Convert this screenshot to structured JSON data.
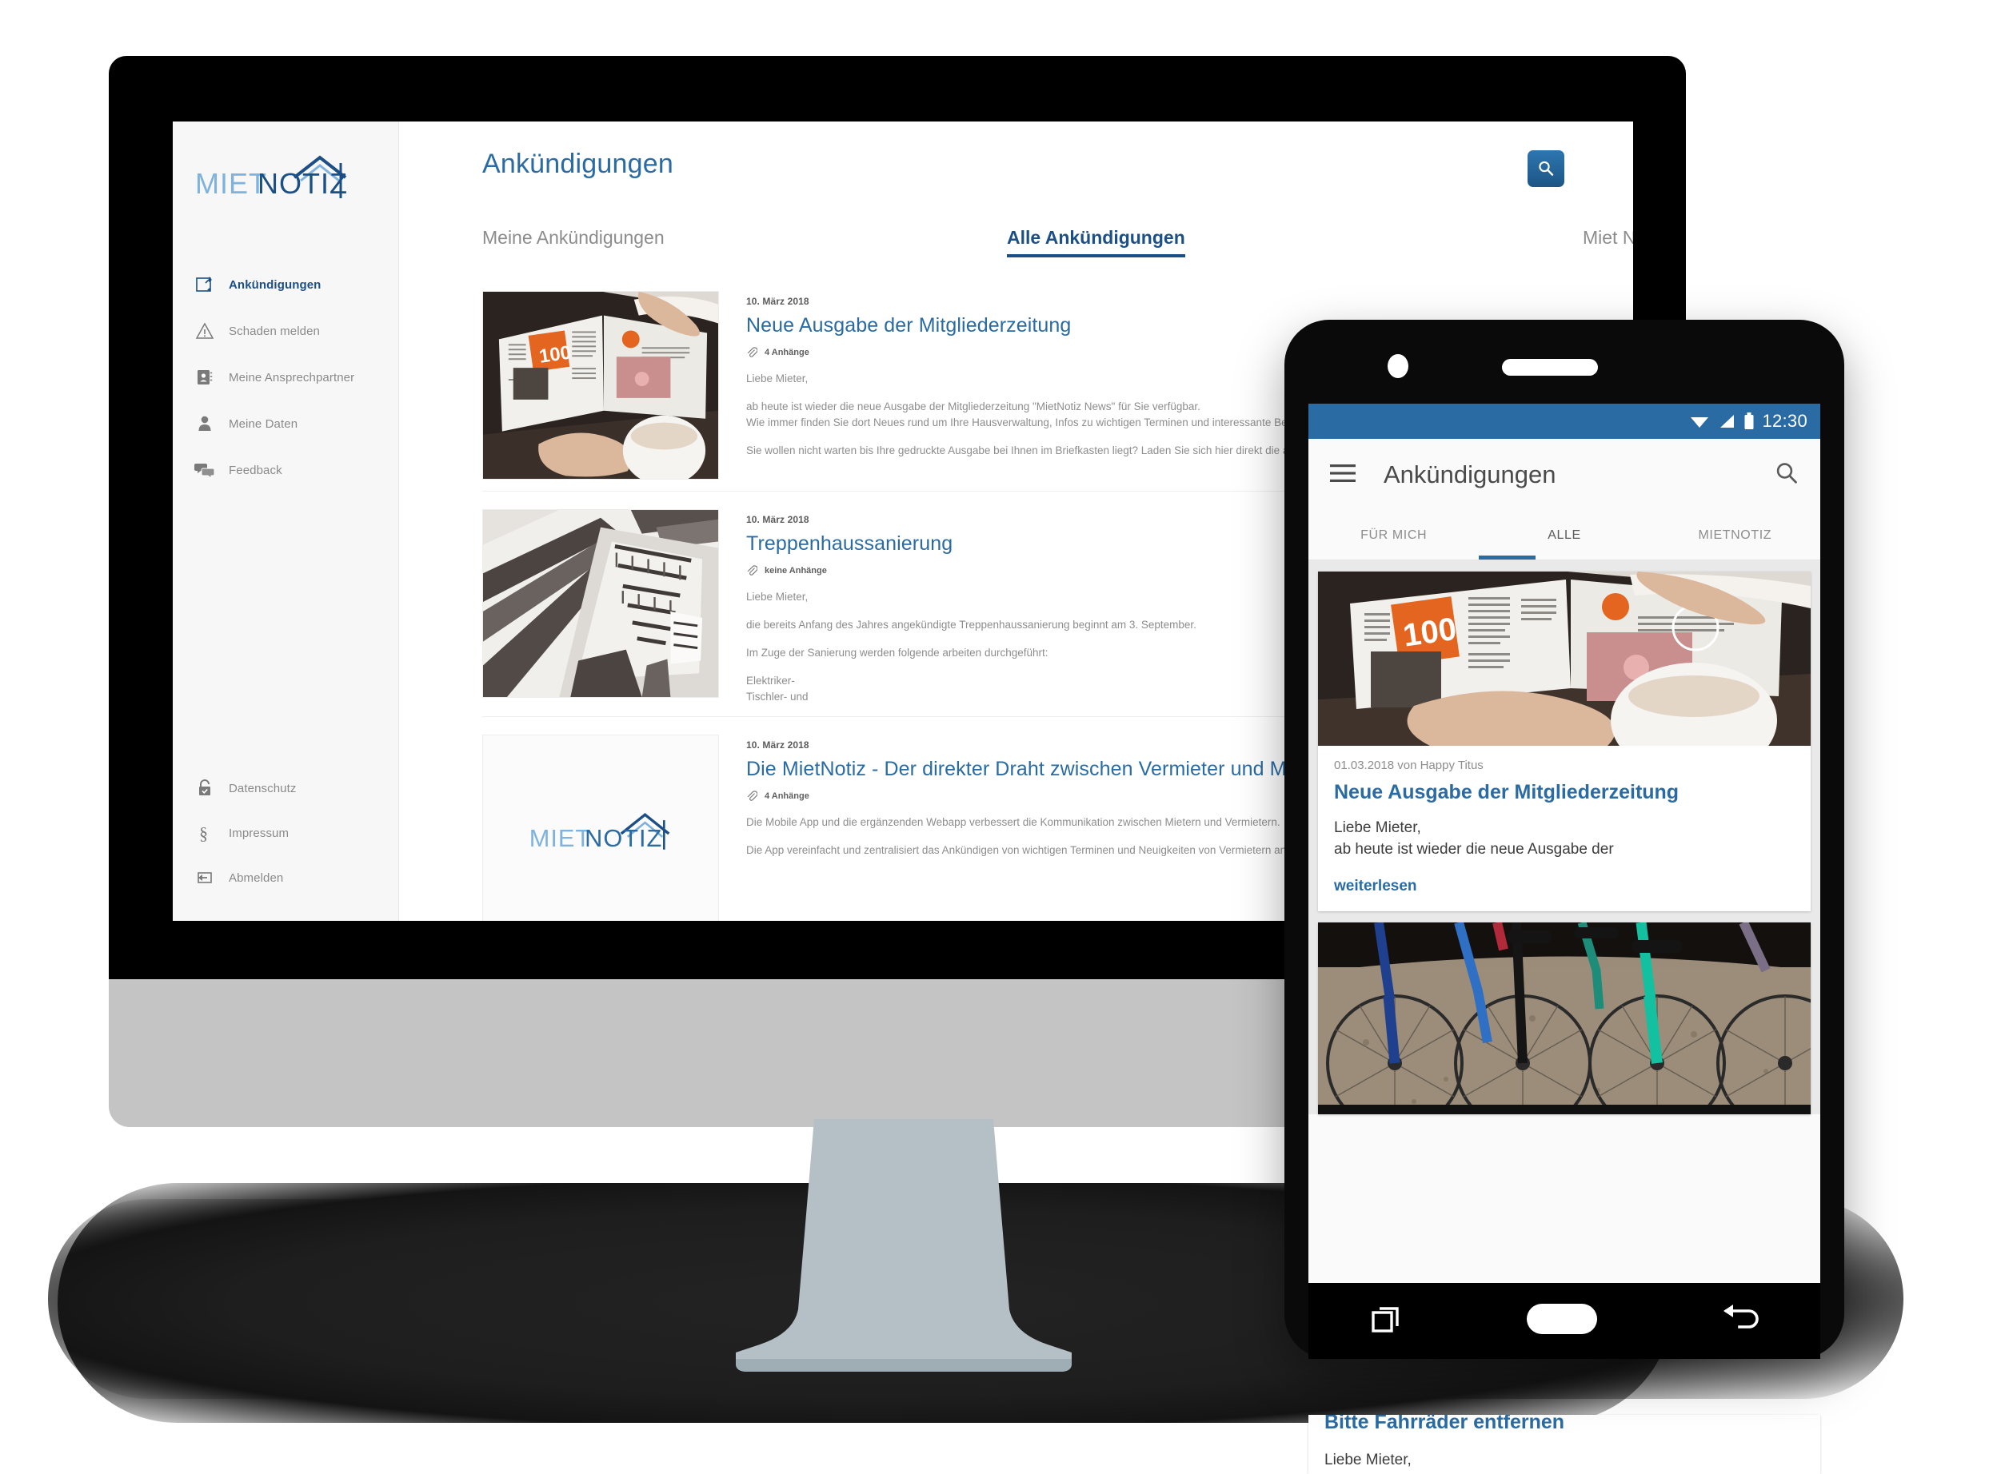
{
  "brand": {
    "logo_first": "MIET",
    "logo_second": "NOTIZ",
    "accent_blue": "#2a6ba3",
    "dark_blue": "#1b4f86",
    "light_blue": "#7fb3dd"
  },
  "desktop": {
    "page_title": "Ankündigungen",
    "search_icon": "search-icon",
    "sidebar": {
      "primary_items": [
        {
          "label": "Ankündigungen",
          "icon": "note-pin-icon",
          "active": true
        },
        {
          "label": "Schaden melden",
          "icon": "warning-triangle-icon",
          "active": false
        },
        {
          "label": "Meine Ansprechpartner",
          "icon": "contact-book-icon",
          "active": false
        },
        {
          "label": "Meine Daten",
          "icon": "person-icon",
          "active": false
        },
        {
          "label": "Feedback",
          "icon": "chat-bubbles-icon",
          "active": false
        }
      ],
      "footer_items": [
        {
          "label": "Datenschutz",
          "icon": "lock-check-icon"
        },
        {
          "label": "Impressum",
          "icon": "paragraph-sign-icon"
        },
        {
          "label": "Abmelden",
          "icon": "logout-arrow-icon"
        }
      ]
    },
    "tabs": [
      {
        "label": "Meine Ankündigungen",
        "active": false
      },
      {
        "label": "Alle Ankündigungen",
        "active": true
      },
      {
        "label": "Miet Notiz",
        "active": false
      }
    ],
    "articles": [
      {
        "date": "10. März 2018",
        "title": "Neue Ausgabe der Mitgliederzeitung",
        "attachments": "4 Anhänge",
        "thumb": "magazine-photo",
        "paragraphs": [
          "Liebe Mieter,",
          "ab heute ist wieder die neue Ausgabe der Mitgliederzeitung \"MietNotiz News\" für Sie verfügbar.\nWie immer finden Sie dort Neues rund um Ihre Hausverwaltung, Infos zu wichtigen Terminen und interessante Berichte aus Ihrer Nachbarschaft!",
          "Sie wollen nicht warten bis Ihre gedruckte Ausgabe bei Ihnen im Briefkasten liegt? Laden Sie sich hier direkt die aktuelle Ausgabe herunter!"
        ]
      },
      {
        "date": "10. März 2018",
        "title": "Treppenhaussanierung",
        "attachments": "keine Anhänge",
        "thumb": "stairwell-photo",
        "paragraphs": [
          "Liebe Mieter,",
          "die bereits Anfang des Jahres angekündigte Treppenhaussanierung beginnt am 3. September.",
          "Im Zuge der Sanierung werden folgende arbeiten durchgeführt:",
          "Elektriker-\nTischler- und"
        ]
      },
      {
        "date": "10. März 2018",
        "title": "Die MietNotiz - Der direkter Draht zwischen Vermieter und Mieter",
        "attachments": "4 Anhänge",
        "thumb": "mietnotiz-logo",
        "paragraphs": [
          "Die Mobile App und die ergänzenden Webapp verbessert die Kommunikation zwischen Mietern und Vermietern.",
          "Die App vereinfacht und zentralisiert das Ankündigen von wichtigen Terminen und Neuigkeiten von Vermietern an Ihre Mieter, sowie das Melden und die Abarbeitung von Schadensmeldungen."
        ]
      }
    ]
  },
  "mobile": {
    "status": {
      "time": "12:30",
      "icons": [
        "wifi-icon",
        "signal-icon",
        "battery-icon"
      ]
    },
    "app_bar": {
      "menu_icon": "hamburger-menu-icon",
      "title": "Ankündigungen",
      "search_icon": "search-icon"
    },
    "tabs": [
      {
        "label": "FÜR MICH",
        "active": false
      },
      {
        "label": "ALLE",
        "active": true
      },
      {
        "label": "MIETNOTIZ",
        "active": false
      }
    ],
    "cards": [
      {
        "image": "magazine-photo",
        "date": "01.03.2018 von Happy Titus",
        "title": "Neue Ausgabe der Mitgliederzeitung",
        "line1": "Liebe Mieter,",
        "line2": "ab heute ist wieder die neue Ausgabe der",
        "more": "weiterlesen"
      },
      {
        "image": "bicycles-photo",
        "date": "",
        "title": "",
        "line1": "",
        "line2": "",
        "more": ""
      }
    ],
    "nav": {
      "overview_icon": "overview-squares-icon",
      "home_icon": "home-pill-icon",
      "back_icon": "back-arrow-icon"
    },
    "trailing_card": {
      "title": "Bitte Fahrräder entfernen",
      "text": "Liebe Mieter,"
    }
  }
}
